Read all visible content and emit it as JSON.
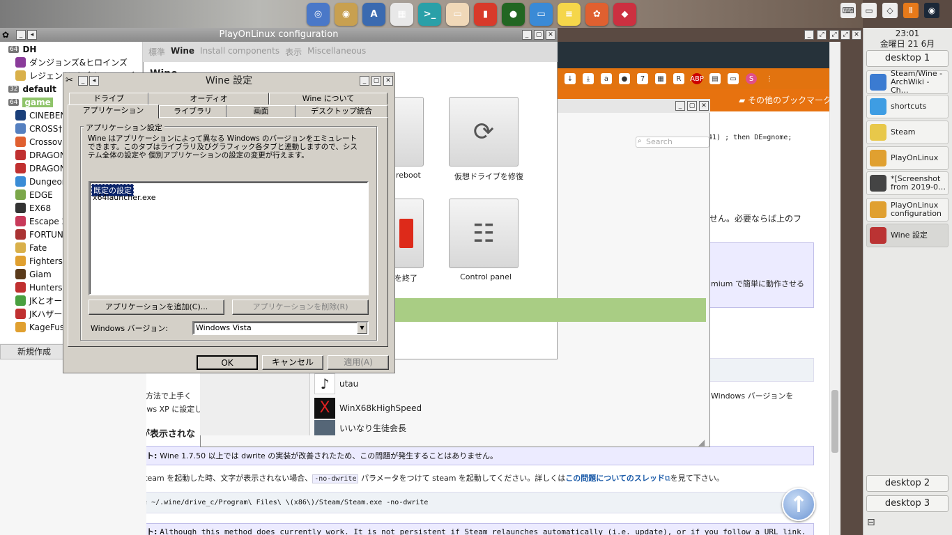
{
  "dock": {
    "icons": [
      "chrome-icon",
      "owl-icon",
      "acme-icon",
      "calc-icon",
      "terminal-icon",
      "files-icon",
      "audio-icon",
      "globe-icon",
      "window-icon",
      "notes-icon",
      "playonlinux-icon",
      "ruby-icon"
    ]
  },
  "clock": {
    "time": "23:01",
    "date": "金曜日 21 6月"
  },
  "panel": {
    "desktops": [
      "desktop 1",
      "desktop 2",
      "desktop 3"
    ],
    "tasks": [
      {
        "label": "Steam/Wine - ArchWiki - Ch…",
        "color": "#3b7bd1"
      },
      {
        "label": "shortcuts",
        "color": "#3e9de3"
      },
      {
        "label": "Steam",
        "color": "#e8c84a"
      },
      {
        "label": "PlayOnLinux",
        "color": "#e0a030"
      },
      {
        "label": "*[Screenshot from 2019-0…",
        "color": "#444444"
      },
      {
        "label": "PlayOnLinux configuration",
        "color": "#e0a030"
      },
      {
        "label": "Wine 設定",
        "color": "#bb3333"
      }
    ]
  },
  "pol": {
    "title": "PlayOnLinux configuration",
    "tree": [
      {
        "badge": "64",
        "label": "DH",
        "bold": true
      },
      {
        "label": "ダンジョンズ&ヒロインズ",
        "color": "#8a3b9a"
      },
      {
        "label": "レジェンド オブ ヒーローズ",
        "color": "#d9b04a"
      },
      {
        "badge": "32",
        "label": "default",
        "bold": true
      },
      {
        "badge": "64",
        "label": "game",
        "bold": true,
        "sel": true
      },
      {
        "label": "CINEBENCH",
        "color": "#1a3f7a"
      },
      {
        "label": "CROSS†CHANNEL",
        "color": "#5580c0"
      },
      {
        "label": "Crossover",
        "color": "#e06030"
      },
      {
        "label": "DRAGON",
        "color": "#c03030"
      },
      {
        "label": "DRAGON",
        "color": "#c03030"
      },
      {
        "label": "Dungeon",
        "color": "#3a8cd6"
      },
      {
        "label": "EDGE",
        "color": "#7ba74a"
      },
      {
        "label": "EX68",
        "color": "#333333"
      },
      {
        "label": "Escape 2",
        "color": "#c83a5a"
      },
      {
        "label": "FORTUNE",
        "color": "#aa3333"
      },
      {
        "label": "Fate",
        "color": "#d9b04a"
      },
      {
        "label": "Fighters",
        "color": "#e0a030"
      },
      {
        "label": "Giam",
        "color": "#5a3a1a"
      },
      {
        "label": "Hunters",
        "color": "#c03030"
      },
      {
        "label": "JKとオーク",
        "color": "#4aa040"
      },
      {
        "label": "JKハザード",
        "color": "#c03030"
      },
      {
        "label": "KageFus",
        "color": "#e0a030"
      }
    ],
    "new_button": "新規作成",
    "tabs": [
      "標準",
      "Wine",
      "Install components",
      "表示",
      "Miscellaneous"
    ],
    "section": "Wine",
    "buttons": [
      {
        "label": "reboot"
      },
      {
        "label": "仮想ドライブを修復"
      },
      {
        "label": "を終了"
      },
      {
        "label": "Control panel"
      }
    ]
  },
  "browser": {
    "bookmarks": "その他のブックマーク",
    "search_placeholder": "Search",
    "code1": "41) ; then DE=gnome;",
    "text1": "せん。必要ならば上のフ",
    "text2": "mium で簡単に動作させる",
    "text3": "上記の方法で上手く",
    "text3b": "Windows バージョンを",
    "text4": "Windows XP に設定し",
    "heading": "文字が表示されな",
    "note1_label": "ノート: ",
    "note1": "Wine 1.7.50 以上では dwrite の実装が改善されたため、この問題が発生することはありません。",
    "para_a": "もし steam を起動した時、文字が表示されない場合、",
    "para_code": "-no-dwrite",
    "para_b": " パラメータをつけて steam を起動してください。詳しくは",
    "para_link": "この問題についてのスレッド",
    "para_c": "を見て下さい。",
    "code2": "wine ~/.wine/drive_c/Program\\ Files\\ \\(x86\\)/Steam/Steam.exe -no-dwrite",
    "note2_label": "ノート: ",
    "note2": "Although this method does currently work. It is not persistent if Steam relaunches automatically (i.e. update), or if you follow a URL link."
  },
  "apps": [
    {
      "label": "utau"
    },
    {
      "label": "WinX68kHighSpeed"
    },
    {
      "label": "いいなり生徒会長"
    }
  ],
  "wine": {
    "title": "Wine 設定",
    "tabs_row1": [
      "ドライブ",
      "オーディオ",
      "Wine について"
    ],
    "tabs_row2": [
      "アプリケーション",
      "ライブラリ",
      "画面",
      "デスクトップ統合"
    ],
    "group_label": "アプリケーション設定",
    "description": "Wine はアプリケーションによって異なる Windows のバージョンをエミュレートできます。このタブはライブラリ及びグラフィック各タブと連動しますので、システム全体の設定や 個別アプリケーションの設定の変更が行えます。",
    "list": [
      {
        "label": "既定の設定",
        "selected": true
      },
      {
        "label": "x64launcher.exe"
      }
    ],
    "add_button": "アプリケーションを追加(C)...",
    "remove_button": "アプリケーションを削除(R)",
    "version_label": "Windows バージョン:",
    "version_value": "Windows Vista",
    "ok": "OK",
    "cancel": "キャンセル",
    "apply": "適用(A)"
  }
}
